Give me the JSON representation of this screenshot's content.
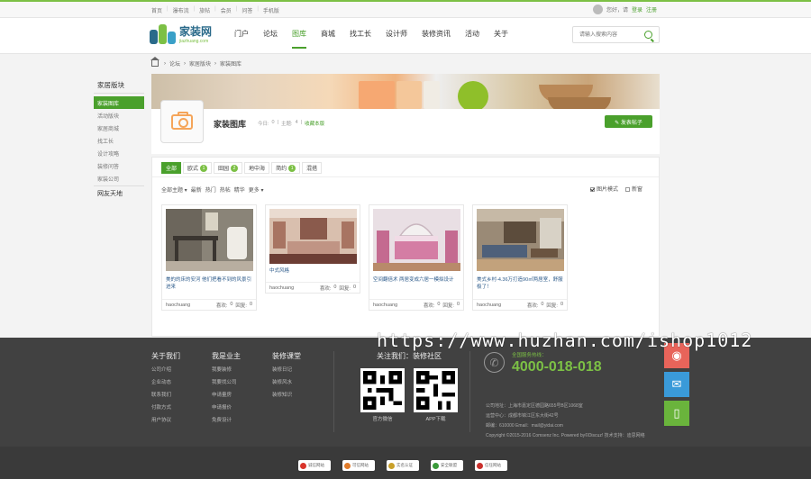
{
  "topbar": {
    "links": [
      "首页",
      "瀑布流",
      "旅帖",
      "会员",
      "问答",
      "手机版"
    ],
    "greeting": "您好，请",
    "login": "登录",
    "register": "注册"
  },
  "header": {
    "logo_cn": "家装网",
    "logo_en": "jiazhuang.com",
    "nav": [
      "门户",
      "论坛",
      "图库",
      "商城",
      "找工长",
      "设计师",
      "装修资讯",
      "活动",
      "关于"
    ],
    "search_placeholder": "请输入搜索内容"
  },
  "breadcrumb": [
    "论坛",
    "家居版块",
    "家装图库"
  ],
  "sidebar": {
    "heading": "家居版块",
    "items": [
      "家装图库",
      "活动版块",
      "家居商城",
      "找工长",
      "设计攻略",
      "装修问答",
      "家装公司"
    ],
    "group": "网友天地"
  },
  "forum": {
    "title": "家装图库",
    "today_label": "今日:",
    "today": "0",
    "topics_label": "主题:",
    "topics": "4",
    "favorite": "收藏本版",
    "post_button": "发表帖子"
  },
  "type_tabs": [
    {
      "label": "全部",
      "count": ""
    },
    {
      "label": "欧式",
      "count": "1"
    },
    {
      "label": "田园",
      "count": "2"
    },
    {
      "label": "地中海",
      "count": ""
    },
    {
      "label": "简约",
      "count": "1"
    },
    {
      "label": "混搭",
      "count": ""
    }
  ],
  "filters": [
    "全部主题",
    "最新",
    "热门",
    "热帖",
    "精华",
    "更多"
  ],
  "view_options": {
    "image_mode": "图片模式",
    "new_window": "新窗"
  },
  "cards": [
    {
      "title": "美的的床的安河 他们把看不到的风景引进来",
      "author": "haochuang",
      "likes_label": "喜欢:",
      "likes": "0",
      "replies_label": "回复:",
      "replies": "0"
    },
    {
      "title": "中式风格",
      "author": "haochuang",
      "likes_label": "喜欢:",
      "likes": "0",
      "replies_label": "回复:",
      "replies": "0"
    },
    {
      "title": "空间翻倍术 两居变成六居一模拟设计",
      "author": "haochuang",
      "likes_label": "喜欢:",
      "likes": "0",
      "replies_label": "回复:",
      "replies": "0"
    },
    {
      "title": "美式乡村-4.36万打造90㎡两居室，舒服极了！",
      "author": "haochuang",
      "likes_label": "喜欢:",
      "likes": "0",
      "replies_label": "回复:",
      "replies": "0"
    }
  ],
  "footer": {
    "columns": [
      {
        "head": "关于我们",
        "links": [
          "公司介绍",
          "企业动态",
          "联系我们",
          "付款方式",
          "用户协议"
        ]
      },
      {
        "head": "我是业主",
        "links": [
          "我要装修",
          "我要找公司",
          "申请量房",
          "申请报价",
          "免费设计"
        ]
      },
      {
        "head": "装修课堂",
        "links": [
          "装修日记",
          "装修风水",
          "装修知识"
        ]
      }
    ],
    "follow_head": "关注我们：装修社区",
    "qr": [
      "官方微信",
      "APP下载"
    ],
    "service_label": "全国服务热线：",
    "hotline": "4000-018-018",
    "company_address": "公司地址：上海市嘉定区德园路655号B区1068室",
    "office": "运营中心：成都市锦江区东大街42号",
    "contact": "邮编：610000 Email：mail@yidai.com",
    "copyright": "Copyright  ©2015-2016  Comsenz Inc.  Powered by©Discuz! 技术支持：迪思网络"
  },
  "watermark": "https://www.huzhan.com/ishop1012",
  "social": [
    {
      "icon": "qq-icon",
      "color": "#e8645a"
    },
    {
      "icon": "wechat-icon",
      "color": "#3a9ad9"
    },
    {
      "icon": "mobile-icon",
      "color": "#6ab43c"
    }
  ],
  "badges": [
    {
      "label": "诚信网站",
      "color": "#d9342b"
    },
    {
      "label": "可信网站",
      "color": "#e07b2a"
    },
    {
      "label": "实名认证",
      "color": "#c9a02a"
    },
    {
      "label": "安全联盟",
      "color": "#3a9a3a"
    },
    {
      "label": "信任网站",
      "color": "#c9302c"
    }
  ],
  "colors": {
    "accent": "#4aa02c",
    "footer_bg": "#414141"
  }
}
